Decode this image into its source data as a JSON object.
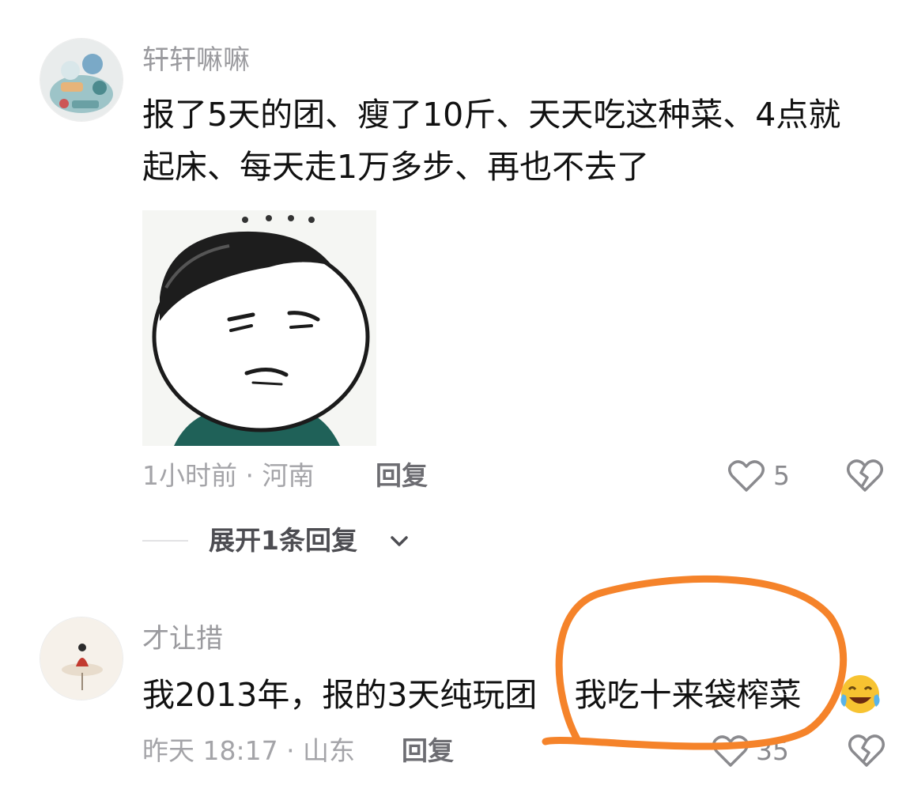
{
  "comments": [
    {
      "username": "轩轩嘛嘛",
      "text_line1": "报了5天的团、瘦了10斤、天天吃这种菜、4点就",
      "text_line2": "起床、每天走1万多步、再也不去了",
      "sticker_icon": "face-meme-sticker",
      "time_location": "1小时前 · 河南",
      "reply_label": "回复",
      "like_count": "5"
    },
    {
      "username": "才让措",
      "text_before": "我2013年，报的3天纯玩团",
      "text_after": "我吃十来袋榨菜",
      "emoji_icon": "laughing-crying-emoji",
      "time_location": "昨天 18:17 · 山东",
      "reply_label": "回复",
      "like_count": "35"
    }
  ],
  "expand_replies": {
    "label": "展开1条回复"
  },
  "colors": {
    "annotation": "#f5832a",
    "secondary_text": "#a4a4a8"
  }
}
